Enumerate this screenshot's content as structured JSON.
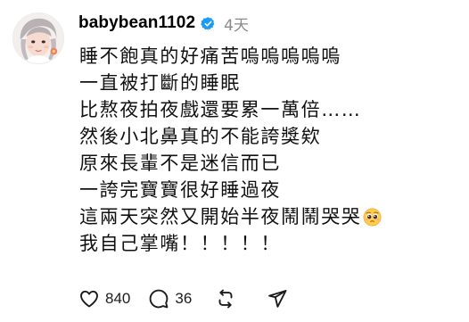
{
  "post": {
    "username": "babybean1102",
    "timestamp": "4天",
    "lines": [
      "睡不飽真的好痛苦嗚嗚嗚嗚嗚",
      "一直被打斷的睡眠",
      "比熬夜拍夜戲還要累一萬倍……",
      "然後小北鼻真的不能誇獎欸",
      "原來長輩不是迷信而已",
      "一誇完寶寶很好睡過夜",
      "這兩天突然又開始半夜鬧鬧哭哭",
      "我自己掌嘴！！！！！"
    ],
    "emoji": "pleading-face-emoji"
  },
  "actions": {
    "like_count": "840",
    "reply_count": "36"
  },
  "colors": {
    "verified_blue": "#1d9bf0",
    "muted_text": "#8a8a8a",
    "icon_stroke": "#1c1c1c"
  }
}
